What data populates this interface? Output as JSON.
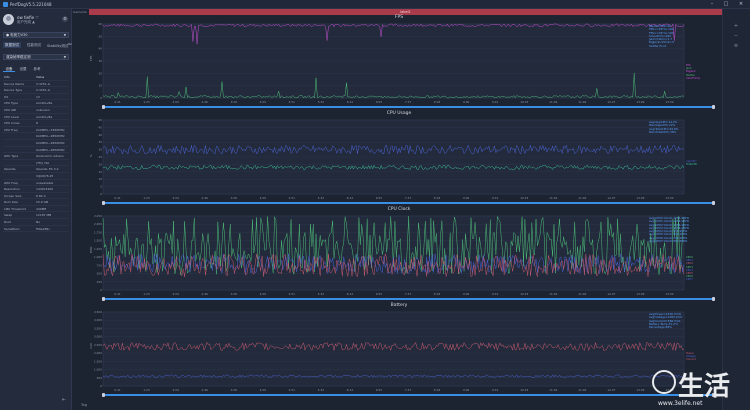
{
  "window": {
    "title": "PerfDogV5.5.221048",
    "min_label": "–",
    "max_label": "□",
    "close_label": "×"
  },
  "sidebar": {
    "user_name": "ow tiefie ♡",
    "user_sub": "用户完成 ▲",
    "device": "● 电竞力V30",
    "nav": [
      "数据测试",
      "性能测试",
      "Stability测试"
    ],
    "nav_super": "Beta",
    "section": "渲染帧率稳定测",
    "tabs": [
      "设备",
      "设置",
      "参考"
    ],
    "info_header": {
      "k": "Info",
      "v": "Value"
    },
    "info_rows": [
      {
        "k": "Device Name",
        "v": "V-3251-G"
      },
      {
        "k": "Device Type",
        "v": "V-3251-G"
      },
      {
        "k": "OS",
        "v": "13"
      },
      {
        "k": "CPU Type",
        "v": "arm64-v8a"
      },
      {
        "k": "CPU ABI",
        "v": "unknown"
      },
      {
        "k": "CPU Level",
        "v": "arm64-v8a"
      },
      {
        "k": "CPU Cores",
        "v": "8"
      },
      {
        "k": "CPU Freq",
        "v": "0x0MHz~3360MHz"
      },
      {
        "k": "",
        "v": "0x0MHz~2850MHz"
      },
      {
        "k": "",
        "v": "0x0MHz~2850MHz"
      },
      {
        "k": "",
        "v": "0x0MHz~2850MHz"
      },
      {
        "k": "GPU Type",
        "v": "Qualcomm Adreno"
      },
      {
        "k": "",
        "v": "(TM) 740"
      },
      {
        "k": "OpenGL",
        "v": "OpenGL ES 3.2"
      },
      {
        "k": "",
        "v": "V@0676.25"
      },
      {
        "k": "GPU Freq",
        "v": "unavailable"
      },
      {
        "k": "Resolution",
        "v": "1440x3200"
      },
      {
        "k": "Screen Size",
        "v": "6.82 in"
      },
      {
        "k": "Rom Size",
        "v": "15.9 GB"
      },
      {
        "k": "LMK Threshold",
        "v": "440MB"
      },
      {
        "k": "Swap",
        "v": "12187 MB"
      },
      {
        "k": "Root",
        "v": "No"
      },
      {
        "k": "SerialNum",
        "v": "f56e284c"
      }
    ],
    "settings_icon": "settings-icon",
    "collapse_icon": "collapse-icon"
  },
  "left_strip": {
    "label": "Game/Ve"
  },
  "session_bar": {
    "label": "label1"
  },
  "statusbar": {
    "label": "Tag"
  },
  "watermark": {
    "text": "生活",
    "url": "www.3elife.net"
  },
  "colors": {
    "bg": "#1c2331",
    "fps_line": "#c94fd6",
    "jank": "#4fbf7a",
    "cpu_total": "#4c63d6",
    "cpu_app": "#3dbf9a",
    "clock_a": "#4fbf7a",
    "clock_b": "#4c63d6",
    "clock_c": "#c95a6f",
    "battery_line": "#c95a6f",
    "accent": "#3b8ee6",
    "session": "#a93b4a"
  },
  "time_ticks": [
    "0:41",
    "1:23",
    "2:04",
    "2:46",
    "3:28",
    "4:09",
    "4:51",
    "5:32",
    "6:14",
    "6:55",
    "7:37",
    "8:18",
    "9:00",
    "9:41",
    "10:23",
    "11:04",
    "11:46",
    "12:27",
    "13:09",
    "13:50"
  ],
  "chart_data": [
    {
      "type": "line",
      "title": "FPS",
      "ylabel": "FPS",
      "ylim": [
        0,
        60
      ],
      "yticks": [
        "0",
        "10",
        "20",
        "30",
        "40",
        "50",
        "60"
      ],
      "series": [
        {
          "name": "FPS",
          "baseline": 59,
          "noise": 1.2
        },
        {
          "name": "Jank",
          "baseline": 1,
          "noise": 1
        }
      ],
      "legend_lines": [
        "Median(FPS):60",
        "FPS>=18(%):100",
        "FPS>=25(%):100",
        "Smooth(%):100",
        "Jank(/10min):1.7",
        "BigJank(/10min):0",
        "Stutter(%):0"
      ],
      "side_legend": [
        "FPS",
        "Jank",
        "BigJank",
        "Stutter",
        "InterFrame"
      ]
    },
    {
      "type": "line",
      "title": "CPU Usage",
      "ylabel": "%",
      "ylim": [
        0,
        50
      ],
      "yticks": [
        "0",
        "5",
        "10",
        "15",
        "20",
        "25",
        "30",
        "35",
        "40",
        "45",
        "50"
      ],
      "series": [
        {
          "name": "TotalCPU",
          "baseline": 30,
          "noise": 3
        },
        {
          "name": "AppCPU",
          "baseline": 18,
          "noise": 1.5
        }
      ],
      "legend_lines": [
        "Avg(AppCPU):14.2%",
        "Max(AppCPU):22%",
        "Avg(TotalCPU):29.8%",
        "Max(TotalCPU):38%"
      ],
      "side_legend": [
        "AppCPU",
        "TotalCPU"
      ]
    },
    {
      "type": "line",
      "title": "CPU Clock",
      "ylabel": "MHz",
      "ylim": [
        0,
        2250
      ],
      "yticks": [
        "0",
        "250",
        "500",
        "750",
        "1,000",
        "1,250",
        "1,500",
        "1,750",
        "2,000",
        "2,250"
      ],
      "series": [
        {
          "name": "CPU0-3",
          "baseline": 1100,
          "noise": 650
        },
        {
          "name": "CPU4-6",
          "baseline": 800,
          "noise": 300
        },
        {
          "name": "CPU7",
          "baseline": 750,
          "noise": 350
        }
      ],
      "legend_lines": [
        "Avg(CPU0 Clock):1054.4MHz",
        "Avg(CPU1 Clock):1054.4MHz",
        "Avg(CPU2 Clock):1054.4MHz",
        "Avg(CPU3 Clock):1054.4MHz",
        "Avg(CPU4 Clock):936.1MHz",
        "Avg(CPU5 Clock):936.1MHz",
        "Avg(CPU6 Clock):936.1MHz",
        "Avg(CPU7 Clock):892.2MHz"
      ],
      "side_legend": [
        "CPU0",
        "CPU1",
        "CPU2",
        "CPU3",
        "CPU4",
        "CPU5",
        "CPU6",
        "CPU7"
      ]
    },
    {
      "type": "line",
      "title": "Battery",
      "ylabel": "mW",
      "ylim": [
        0,
        4500
      ],
      "yticks": [
        "0",
        "500",
        "1,000",
        "1,500",
        "2,000",
        "2,500",
        "3,000",
        "3,500",
        "4,000",
        "4,500"
      ],
      "series": [
        {
          "name": "Power",
          "baseline": 2400,
          "noise": 250
        },
        {
          "name": "Current",
          "baseline": 600,
          "noise": 80
        }
      ],
      "legend_lines": [
        "Avg(Power):2436.7mW",
        "Avg(Voltage):4305.2mV",
        "Avg(Current):566.3mA",
        "Battery Temp:31.2°C",
        "Percentage:88%"
      ],
      "side_legend": [
        "Power",
        "Voltage",
        "Current"
      ]
    }
  ]
}
